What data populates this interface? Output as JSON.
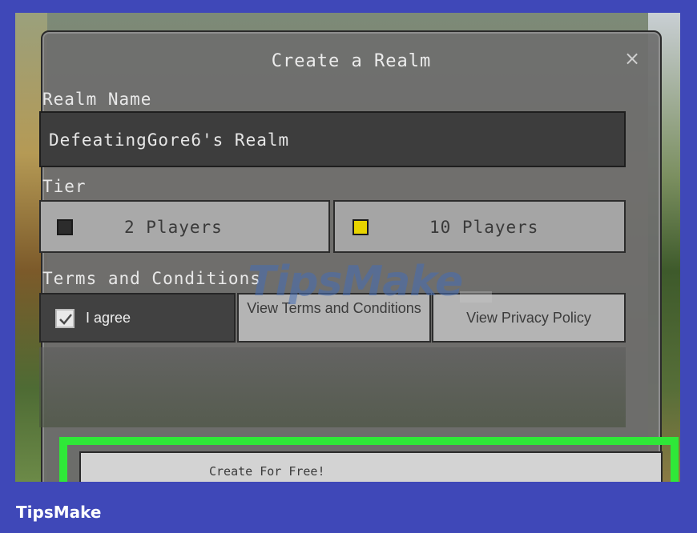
{
  "dialog": {
    "title": "Create a Realm",
    "close_label": "×"
  },
  "realm_name": {
    "label": "Realm Name",
    "value": "DefeatingGore6's Realm"
  },
  "tier": {
    "label": "Tier",
    "options": [
      {
        "label": "2 Players",
        "selected": false,
        "swatch_color": "#2c2c2c"
      },
      {
        "label": "10 Players",
        "selected": true,
        "swatch_color": "#e8d400"
      }
    ]
  },
  "terms": {
    "label": "Terms and Conditions",
    "agree_label": "I agree",
    "agree_checked": true,
    "view_terms_label": "View Terms and Conditions",
    "view_privacy_label": "View Privacy Policy"
  },
  "create_button": {
    "label": "Create For Free!",
    "highlight_color": "#2fe838"
  },
  "watermark": "TipsMake",
  "brand": "TipsMake",
  "colors": {
    "background": "#3f48b8",
    "highlight": "#2fe838"
  }
}
